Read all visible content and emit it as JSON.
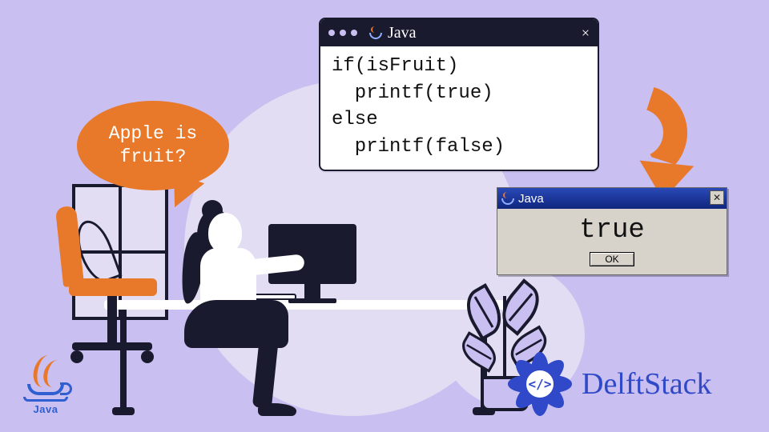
{
  "speech": {
    "text": "Apple is\nfruit?"
  },
  "code_window": {
    "title": "Java",
    "body": "if(isFruit)\n  printf(true)\nelse\n  printf(false)"
  },
  "dialog": {
    "title": "Java",
    "message": "true",
    "ok_label": "OK"
  },
  "logos": {
    "java_label": "Java",
    "delft_label": "DelftStack",
    "code_glyph": "</>"
  },
  "colors": {
    "bg": "#c9bff0",
    "accent": "#e8792b",
    "ink": "#1a1a2e",
    "brand_blue": "#2f49c9",
    "dialog_title": "#10267e"
  }
}
